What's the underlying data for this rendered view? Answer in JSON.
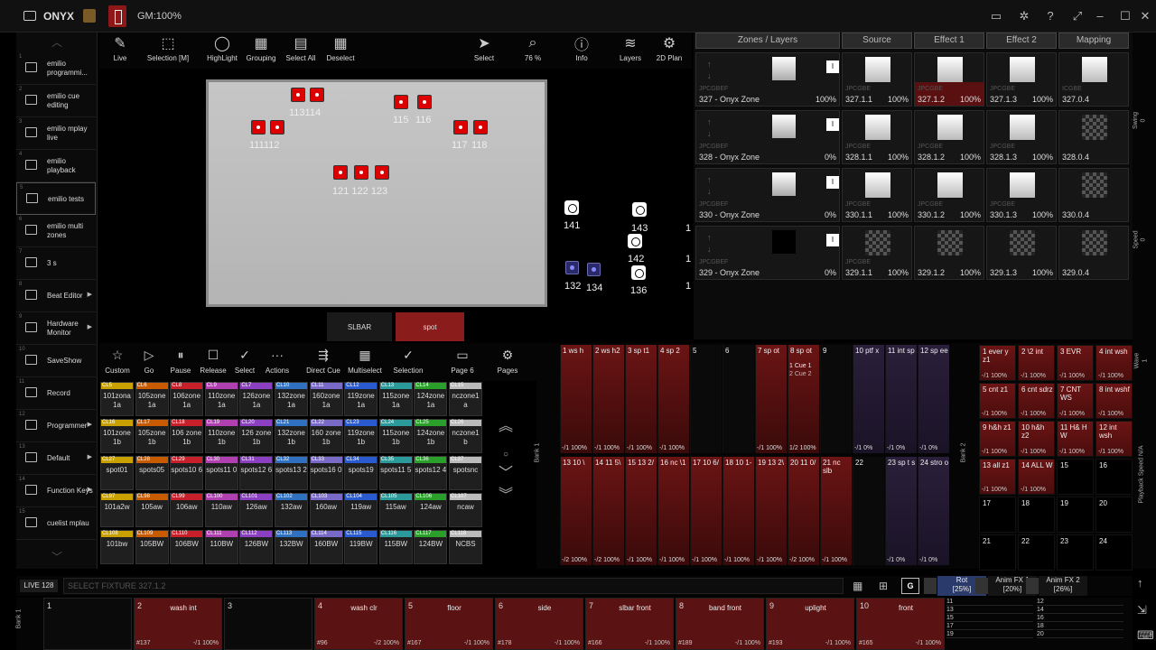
{
  "titlebar": {
    "app": "ONYX",
    "gm": "GM:100%"
  },
  "sidebar": {
    "items": [
      {
        "num": "1",
        "label": "emilio programmi...",
        "arrow": ""
      },
      {
        "num": "2",
        "label": "emilio cue editing",
        "arrow": ""
      },
      {
        "num": "3",
        "label": "emilio mplay live",
        "arrow": ""
      },
      {
        "num": "4",
        "label": "emilio playback",
        "arrow": ""
      },
      {
        "num": "5",
        "label": "emilio tests",
        "arrow": ""
      },
      {
        "num": "6",
        "label": "emilio multi zones",
        "arrow": ""
      },
      {
        "num": "7",
        "label": "3 s",
        "arrow": ""
      },
      {
        "num": "8",
        "label": "Beat Editor",
        "arrow": "▶"
      },
      {
        "num": "9",
        "label": "Hardware Monitor",
        "arrow": "▶"
      },
      {
        "num": "10",
        "label": "SaveShow",
        "arrow": ""
      },
      {
        "num": "11",
        "label": "Record",
        "arrow": ""
      },
      {
        "num": "12",
        "label": "Programmer",
        "arrow": "▶"
      },
      {
        "num": "13",
        "label": "Default",
        "arrow": "▶"
      },
      {
        "num": "14",
        "label": "Function Keys",
        "arrow": "▶"
      },
      {
        "num": "15",
        "label": "cuelist mplau",
        "arrow": ""
      }
    ]
  },
  "toolbar": {
    "live": "Live",
    "selection": "Selection [M]",
    "highlight": "HighLight",
    "grouping": "Grouping",
    "selectall": "Select All",
    "deselect": "Deselect",
    "select": "Select",
    "zoom": "76 %",
    "info": "Info",
    "layers": "Layers",
    "plan2d": "2D Plan"
  },
  "plan": {
    "labels": [
      "113114",
      "111112",
      "115",
      "116",
      "117",
      "118",
      "121 122 123",
      "141",
      "143",
      "142",
      "132",
      "134",
      "136",
      "1",
      "1",
      "1"
    ]
  },
  "tabs": {
    "slbar": "SLBAR",
    "spot": "spot"
  },
  "zones": {
    "headers": [
      "Zones / Layers",
      "Source",
      "Effect 1",
      "Effect 2",
      "Mapping"
    ],
    "rows": [
      {
        "name": "327 - Onyx Zone",
        "type": "JPCGBEF",
        "pct": "100%",
        "cells": [
          [
            "JPCGBE",
            "327.1.1",
            "100%"
          ],
          [
            "JPCGBE",
            "327.1.2",
            "100%"
          ],
          [
            "JPCGBE",
            "327.1.3",
            "100%"
          ],
          [
            "ICGBE",
            "327.0.4",
            ""
          ]
        ]
      },
      {
        "name": "328 - Onyx Zone",
        "type": "JPCGBEF",
        "pct": "0%",
        "cells": [
          [
            "JPCGBE",
            "328.1.1",
            "100%"
          ],
          [
            "JPCGBE",
            "328.1.2",
            "100%"
          ],
          [
            "JPCGBE",
            "328.1.3",
            "100%"
          ],
          [
            "",
            "328.0.4",
            ""
          ]
        ]
      },
      {
        "name": "330 - Onyx Zone",
        "type": "JPCGBEF",
        "pct": "0%",
        "cells": [
          [
            "JPCGBE",
            "330.1.1",
            "100%"
          ],
          [
            "JPCGBE",
            "330.1.2",
            "100%"
          ],
          [
            "JPCGBE",
            "330.1.3",
            "100%"
          ],
          [
            "",
            "330.0.4",
            ""
          ]
        ]
      },
      {
        "name": "329 - Onyx Zone",
        "type": "JPCGBEF",
        "pct": "0%",
        "cells": [
          [
            "JPCGBE",
            "329.1.1",
            "100%"
          ],
          [
            "",
            "329.1.2",
            "100%"
          ],
          [
            "",
            "329.1.3",
            "100%"
          ],
          [
            "",
            "329.0.4",
            ""
          ]
        ]
      }
    ]
  },
  "rightstrip": {
    "swing": "Swing",
    "swing_v": "0",
    "speed": "Speed",
    "speed_v": "0",
    "wave": "Wave",
    "wave_v": "1",
    "pbspeed": "Playback Speed N/A"
  },
  "cuetoolbar": {
    "custom": "Custom",
    "go": "Go",
    "pause": "Pause",
    "release": "Release",
    "select": "Select",
    "actions": "Actions",
    "directcue": "Direct Cue",
    "multiselect": "Multiselect",
    "selection": "Selection",
    "page": "Page 6",
    "pages": "Pages"
  },
  "cuelists": [
    [
      "CL5",
      "101zona 1a"
    ],
    [
      "CL6",
      "105zone 1a"
    ],
    [
      "CL8",
      "106zone 1a"
    ],
    [
      "CL9",
      "110zone 1a"
    ],
    [
      "CL7",
      "126zone 1a"
    ],
    [
      "CL10",
      "132zone 1a"
    ],
    [
      "CL11",
      "160zone 1a"
    ],
    [
      "CL12",
      "119zone 1a"
    ],
    [
      "CL13",
      "115zone 1a"
    ],
    [
      "CL14",
      "124zone 1a"
    ],
    [
      "CL15",
      "nczone1 a"
    ],
    [
      "CL16",
      "101zone 1b"
    ],
    [
      "CL17",
      "105zone 1b"
    ],
    [
      "CL18",
      "106 zone 1b"
    ],
    [
      "CL19",
      "110zone 1b"
    ],
    [
      "CL20",
      "126 zone 1b"
    ],
    [
      "CL21",
      "132zone 1b"
    ],
    [
      "CL22",
      "160 zone 1b"
    ],
    [
      "CL23",
      "119zone 1b"
    ],
    [
      "CL24",
      "115zone 1b"
    ],
    [
      "CL25",
      "124zone 1b"
    ],
    [
      "CL26",
      "nczone1 b"
    ],
    [
      "CL27",
      "spot01"
    ],
    [
      "CL28",
      "spots05"
    ],
    [
      "CL29",
      "spots10 6"
    ],
    [
      "CL30",
      "spots11 0"
    ],
    [
      "CL31",
      "spots12 6"
    ],
    [
      "CL32",
      "spots13 2"
    ],
    [
      "CL33",
      "spots16 0"
    ],
    [
      "CL34",
      "spots19"
    ],
    [
      "CL35",
      "spots11 5"
    ],
    [
      "CL36",
      "spots12 4"
    ],
    [
      "CL37",
      "spotsnc"
    ],
    [
      "CL97",
      "101a2w"
    ],
    [
      "CL98",
      "105aw"
    ],
    [
      "CL99",
      "106aw"
    ],
    [
      "CL100",
      "110aw"
    ],
    [
      "CL101",
      "126aw"
    ],
    [
      "CL102",
      "132aw"
    ],
    [
      "CL103",
      "160aw"
    ],
    [
      "CL104",
      "119aw"
    ],
    [
      "CL105",
      "115aw"
    ],
    [
      "CL106",
      "124aw"
    ],
    [
      "CL107",
      "ncaw"
    ],
    [
      "CL108",
      "101bw"
    ],
    [
      "CL109",
      "105BW"
    ],
    [
      "CL110",
      "106BW"
    ],
    [
      "CL111",
      "110BW"
    ],
    [
      "CL112",
      "126BW"
    ],
    [
      "CL113",
      "132BW"
    ],
    [
      "CL114",
      "160BW"
    ],
    [
      "CL115",
      "119BW"
    ],
    [
      "CL116",
      "115BW"
    ],
    [
      "CL117",
      "124BW"
    ],
    [
      "CL118",
      "NCBS"
    ]
  ],
  "bank1": {
    "label": "Bank 1",
    "top": [
      [
        "1 ws h",
        "-/1 100%"
      ],
      [
        "2 ws h2",
        "-/1 100%"
      ],
      [
        "3 sp t1",
        "-/1 100%"
      ],
      [
        "4 sp 2",
        "-/1 100%"
      ],
      [
        "5",
        ""
      ],
      [
        "6",
        ""
      ],
      [
        "7 sp ot",
        "-/1 100%"
      ],
      [
        "8 sp ot",
        "1/2 100%"
      ],
      [
        "9",
        ""
      ],
      [
        "10 ptf x",
        "-/1 0%"
      ],
      [
        "11 int sp",
        "-/1 0%"
      ],
      [
        "12 sp ee",
        "-/1 0%"
      ]
    ],
    "bottom": [
      [
        "13 10 \\",
        "-/2 100%"
      ],
      [
        "14 11 5\\",
        "-/2 100%"
      ],
      [
        "15 13 2/",
        "-/1 100%"
      ],
      [
        "16 nc \\1",
        "-/1 100%"
      ],
      [
        "17 10 6/",
        "-/1 100%"
      ],
      [
        "18 10 1-",
        "-/1 100%"
      ],
      [
        "19 13 2\\",
        "-/1 100%"
      ],
      [
        "20 11 0/",
        "-/2 100%"
      ],
      [
        "21 nc slb",
        "-/1 100%"
      ],
      [
        "22",
        ""
      ],
      [
        "23 sp t s",
        "-/1 0%"
      ],
      [
        "24 stro o",
        "-/1 0%"
      ]
    ],
    "cue": "1 Cue 1",
    "cue2": "2 Cue 2"
  },
  "bank2": {
    "label": "Bank 2",
    "items": [
      [
        "1 ever y z1",
        "-/1 100%"
      ],
      [
        "2 \\2 int",
        "-/1 100%"
      ],
      [
        "3 EVR",
        "-/1 100%"
      ],
      [
        "4 int wsh",
        "-/1 100%"
      ],
      [
        "5 cnt z1",
        "-/1 100%"
      ],
      [
        "6 cnt sdrz",
        "-/1 100%"
      ],
      [
        "7 CNT WS",
        "-/1 100%"
      ],
      [
        "8 int wshf",
        "-/1 100%"
      ],
      [
        "9 h&h z1",
        "-/1 100%"
      ],
      [
        "10 h&h z2",
        "-/1 100%"
      ],
      [
        "11 H& H W",
        "-/1 100%"
      ],
      [
        "12 int wsh",
        "-/1 100%"
      ],
      [
        "13 all z1",
        "-/1 100%"
      ],
      [
        "14 ALL W",
        "-/1 100%"
      ],
      [
        "15",
        ""
      ],
      [
        "16",
        ""
      ],
      [
        "17",
        ""
      ],
      [
        "18",
        ""
      ],
      [
        "19",
        ""
      ],
      [
        "20",
        ""
      ],
      [
        "21",
        ""
      ],
      [
        "22",
        ""
      ],
      [
        "23",
        ""
      ],
      [
        "24",
        ""
      ]
    ]
  },
  "cmd": {
    "live": "LIVE 128",
    "text": "SELECT FIXTURE 327.1.2",
    "g": "G",
    "rot": "Rot",
    "rot_v": "[25%]",
    "anim1": "Anim FX 1",
    "anim1_v": "[20%]",
    "anim2": "Anim FX 2",
    "anim2_v": "[26%]"
  },
  "bottombank": {
    "label": "Bank 1",
    "items": [
      [
        "1",
        "",
        "",
        ""
      ],
      [
        "2",
        "wash int",
        "#137",
        "-/1 100%"
      ],
      [
        "3",
        "",
        "",
        ""
      ],
      [
        "4",
        "wash clr",
        "#96",
        "-/2 100%"
      ],
      [
        "5",
        "floor",
        "#167",
        "-/1 100%"
      ],
      [
        "6",
        "side",
        "#178",
        "-/1 100%"
      ],
      [
        "7",
        "slbar front",
        "#166",
        "-/1 100%"
      ],
      [
        "8",
        "band front",
        "#189",
        "-/1 100%"
      ],
      [
        "9",
        "uplight",
        "#193",
        "-/1 100%"
      ],
      [
        "10",
        "front",
        "#165",
        "-/1 100%"
      ]
    ],
    "right": [
      "11",
      "12",
      "13",
      "14",
      "15",
      "16",
      "17",
      "18",
      "19",
      "20"
    ]
  }
}
